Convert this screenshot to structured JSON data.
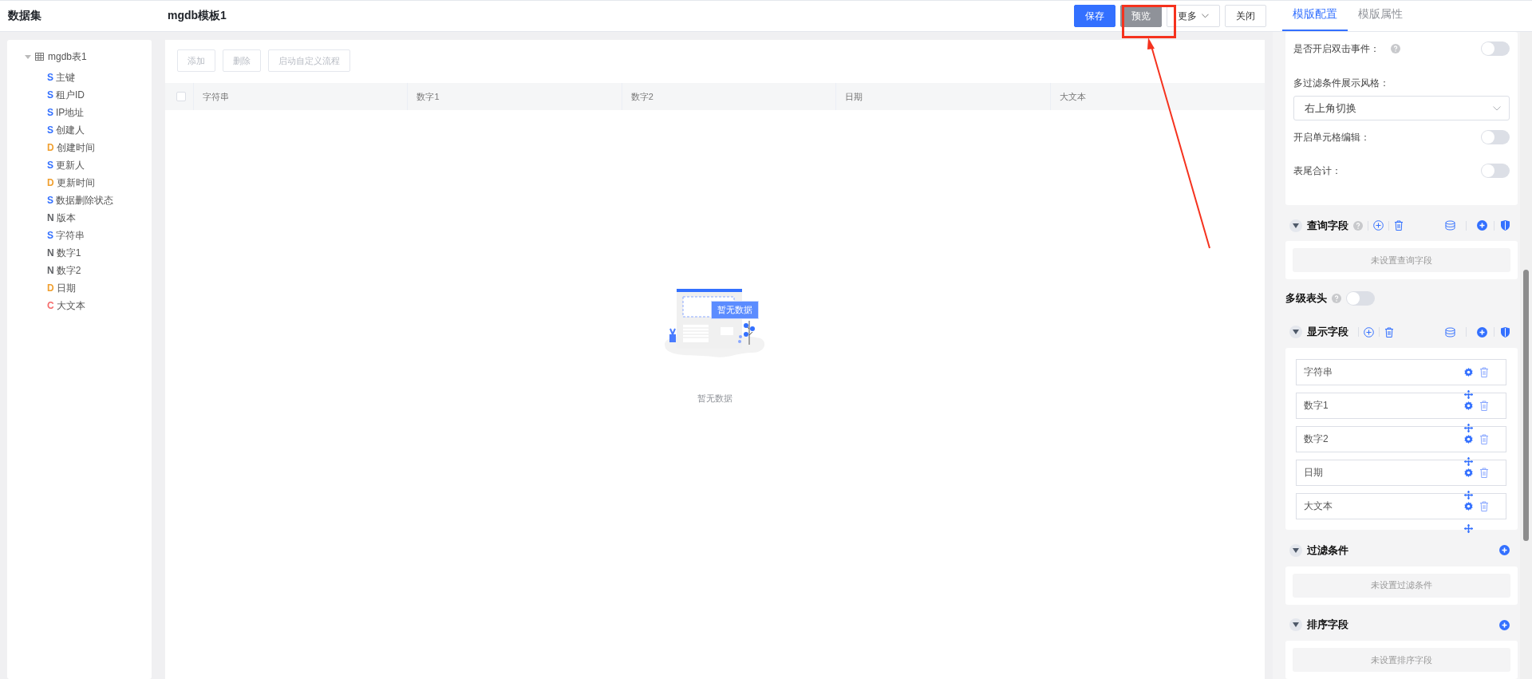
{
  "sidebar": {
    "title": "数据集",
    "tree": [
      {
        "label": "mgdb表1",
        "expanded": true,
        "children": [
          {
            "type": "S",
            "label": "主键",
            "color": "#3370ff"
          },
          {
            "type": "S",
            "label": "租户ID",
            "color": "#3370ff"
          },
          {
            "type": "S",
            "label": "IP地址",
            "color": "#3370ff"
          },
          {
            "type": "S",
            "label": "创建人",
            "color": "#3370ff"
          },
          {
            "type": "D",
            "label": "创建时间",
            "color": "#f0a030"
          },
          {
            "type": "S",
            "label": "更新人",
            "color": "#3370ff"
          },
          {
            "type": "D",
            "label": "更新时间",
            "color": "#f0a030"
          },
          {
            "type": "S",
            "label": "数据删除状态",
            "color": "#3370ff"
          },
          {
            "type": "N",
            "label": "版本",
            "color": "#606266"
          },
          {
            "type": "S",
            "label": "字符串",
            "color": "#3370ff"
          },
          {
            "type": "N",
            "label": "数字1",
            "color": "#606266"
          },
          {
            "type": "N",
            "label": "数字2",
            "color": "#606266"
          },
          {
            "type": "D",
            "label": "日期",
            "color": "#f0a030"
          },
          {
            "type": "C",
            "label": "大文本",
            "color": "#f56c6c"
          }
        ]
      }
    ]
  },
  "header": {
    "title": "mgdb模板1",
    "buttons": [
      {
        "label": "保存",
        "kind": "primary"
      },
      {
        "label": "预览",
        "kind": "gray"
      },
      {
        "label": "更多",
        "kind": "dropdown"
      },
      {
        "label": "关闭",
        "kind": "default"
      }
    ]
  },
  "toolbar": {
    "buttons": [
      {
        "label": "添加",
        "disabled": true
      },
      {
        "label": "删除",
        "disabled": true
      },
      {
        "label": "启动自定义流程",
        "disabled": true
      }
    ]
  },
  "table": {
    "select_all_checked": false,
    "columns": [
      "字符串",
      "数字1",
      "数字2",
      "日期",
      "大文本"
    ]
  },
  "empty_state": {
    "badge": "暂无数据",
    "text": "暂无数据"
  },
  "config_tabs": [
    {
      "label": "模版配置",
      "selected": true
    },
    {
      "label": "模版属性",
      "selected": false
    }
  ],
  "settings": [
    {
      "kind": "switch",
      "label": "是否开启双击事件：",
      "help": true,
      "on": false
    },
    {
      "kind": "select",
      "label": "多过滤条件展示风格：",
      "value": "右上角切换"
    },
    {
      "kind": "switch",
      "label": "开启单元格编辑：",
      "help": false,
      "on": false
    },
    {
      "kind": "switch",
      "label": "表尾合计：",
      "help": false,
      "on": false
    }
  ],
  "sections": [
    {
      "kind": "fields",
      "title": "查询字段",
      "help": true,
      "expanded": true,
      "full_toolbar": true,
      "empty_text": "未设置查询字段"
    },
    {
      "kind": "switch",
      "title": "多级表头",
      "help": true,
      "on": false
    },
    {
      "kind": "fields",
      "title": "显示字段",
      "help": false,
      "expanded": true,
      "full_toolbar": true,
      "fields": [
        "字符串",
        "数字1",
        "数字2",
        "日期",
        "大文本"
      ]
    },
    {
      "kind": "fields",
      "title": "过滤条件",
      "help": false,
      "expanded": true,
      "full_toolbar": false,
      "empty_text": "未设置过滤条件"
    },
    {
      "kind": "fields",
      "title": "排序字段",
      "help": false,
      "expanded": true,
      "full_toolbar": false,
      "empty_text": "未设置排序字段"
    }
  ]
}
